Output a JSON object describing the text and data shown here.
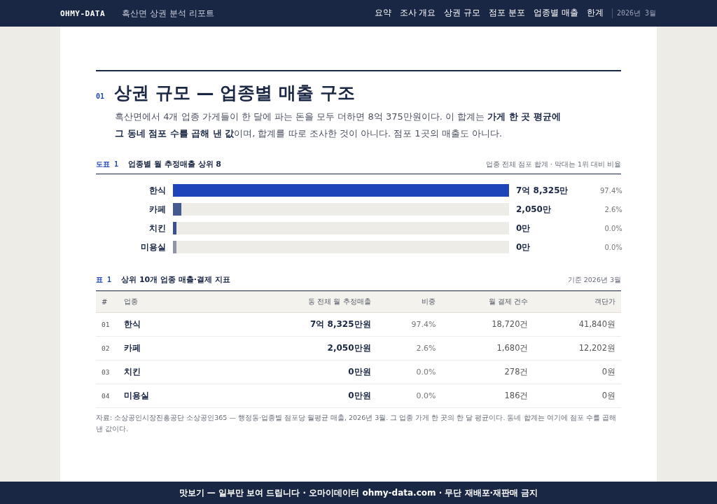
{
  "header": {
    "logo": "OHMY-DATA",
    "title": "흑산면 상권 분석 리포트",
    "nav": [
      {
        "label": "요약",
        "selected": false
      },
      {
        "label": "조사 개요",
        "selected": false
      },
      {
        "label": "상권 규모",
        "selected": false
      },
      {
        "label": "점포 분포",
        "selected": false
      },
      {
        "label": "업종별 매출",
        "selected": false
      },
      {
        "label": "한계",
        "selected": false
      }
    ],
    "date": "2026년 3월"
  },
  "section": {
    "number": "01",
    "title": "상권 규모 — 업종별 매출 구조",
    "lead": "흑산면에서 4개 업종 가게들이 한 달에 파는 돈을 모두 더하면 8억 375만원이다. 이 합계는 **가게 한 곳 평균에 그 동네 점포 수를 곱해 낸 값**이며, 합계를 따로 조사한 것이 아니다. 점포 1곳의 매출도 아니다."
  },
  "figure": {
    "label": "도표 1",
    "title": "업종별 월 추정매출 상위 8",
    "note": "업종 전체 점포 합계 · 막대는 1위 대비 비율",
    "bars": [
      {
        "name": "한식",
        "level": 1,
        "color": "#1d44b8",
        "value": "7억 8,325만",
        "share": "97.4%"
      },
      {
        "name": "카페",
        "level": 0.026,
        "color": "#44598f",
        "value": "2,050만",
        "share": "2.6%"
      },
      {
        "name": "치킨",
        "level": 0.01,
        "color": "#3a5190",
        "value": "0만",
        "share": "0.0%"
      },
      {
        "name": "미용실",
        "level": 0.01,
        "color": "#8e95a8",
        "value": "0만",
        "share": "0.0%"
      }
    ]
  },
  "table": {
    "label": "표 1",
    "title": "상위 10개 업종 매출·결제 지표",
    "note": "기준 2026년 3월",
    "columns": [
      "#",
      "업종",
      "동 전체 월 추정매출",
      "비중",
      "월 결제 건수",
      "객단가"
    ],
    "rows": [
      [
        "01",
        "한식",
        "7억 8,325만원",
        "97.4%",
        "18,720건",
        "41,840원"
      ],
      [
        "02",
        "카페",
        "2,050만원",
        "2.6%",
        "1,680건",
        "12,202원"
      ],
      [
        "03",
        "치킨",
        "0만원",
        "0.0%",
        "278건",
        "0원"
      ],
      [
        "04",
        "미용실",
        "0만원",
        "0.0%",
        "186건",
        "0원"
      ]
    ],
    "source": "자료: 소상공인시장진흥공단 소상공인365 — 행정동·업종별 점포당 월평균 매출, 2026년 3월. 그 업종 가게 한 곳의 한 달 평균이다. 동네 합계는 여기에 점포 수를 곱해 낸 값이다."
  },
  "banner": "맛보기 — 일부만 보여 드립니다 · 오마이데이터 ohmy-data.com · 무단 재배포·재판매 금지"
}
